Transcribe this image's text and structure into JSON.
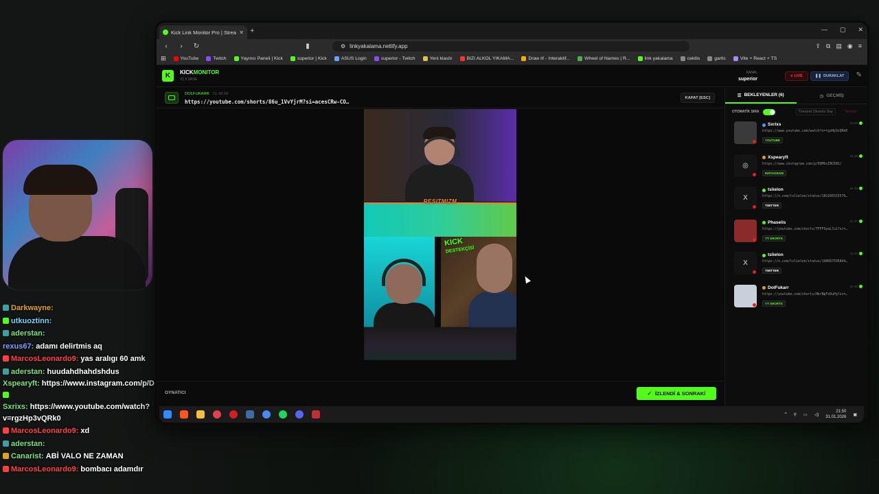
{
  "browser": {
    "tab_title": "Kick Link Monitor Pro | Stream",
    "address": "linkyakalama.netlify.app",
    "bookmarks": [
      {
        "label": "YouTube",
        "color": "#ff0000"
      },
      {
        "label": "Twitch",
        "color": "#9146ff"
      },
      {
        "label": "Yayıncı Paneli | Kick",
        "color": "#53fc18"
      },
      {
        "label": "superior | Kick",
        "color": "#53fc18"
      },
      {
        "label": "ASUS Login",
        "color": "#6aa0ff"
      },
      {
        "label": "superior - Twitch",
        "color": "#9146ff"
      },
      {
        "label": "Yeni klasör",
        "color": "#e0c050"
      },
      {
        "label": "BIZI ALKOL YIKAMA...",
        "color": "#ff3030"
      },
      {
        "label": "Draw it! - Interaktif...",
        "color": "#ffaa00"
      },
      {
        "label": "Wheel of Names | R...",
        "color": "#4caf50"
      },
      {
        "label": "link yakalama",
        "color": "#53fc18"
      },
      {
        "label": "cekilis",
        "color": "#888888"
      },
      {
        "label": "gartic",
        "color": "#888888"
      },
      {
        "label": "Vite + React + TS",
        "color": "#a78bfa"
      }
    ]
  },
  "app": {
    "logo_letter": "K",
    "brand_kick": "KICK",
    "brand_monitor": "MONITOR",
    "version": "V1.5 SRSE",
    "channel_label": "KANAL",
    "channel_name": "superior",
    "live_label": "LIVE",
    "pause_label": "DURAKLAT",
    "now_playing": {
      "user": "DOLFUKARR",
      "time": "21:49:58",
      "url": "https://youtube.com/shorts/86u_1VvYjrM?si=acesCRw-CO…"
    },
    "close_label": "KAPAT [ESC]",
    "video_overlay_text": "RESITMIZM",
    "video_kick_text": "KICK",
    "video_kick_sub": "DESTEKÇİSİ",
    "footer_label": "OYNATICI",
    "next_label": "İZLENDİ & SONRAKİ"
  },
  "side": {
    "tab_waiting": "BEKLEYENLER (6)",
    "tab_history": "GEÇMİŞ",
    "auto_label": "OTOMATİK SIRA",
    "read_all": "Tümünü Okundu Say",
    "clear": "Temizle",
    "queue": [
      {
        "user": "Sxrixs",
        "url": "https://www.youtube.com/watch?v=rgzHp3vQRk0",
        "tag": "YOUTUBE",
        "time": "21:50",
        "dot": "#3aa0ff",
        "thumb": "",
        "tag_color": "#53fc18"
      },
      {
        "user": "Xspearyft",
        "url": "https://www.instagram.com/p/DQMUsIBCEN1/",
        "tag": "INSTAGRAM",
        "time": "21:49",
        "dot": "#e0a020",
        "thumb": "◎",
        "tag_color": "#53fc18"
      },
      {
        "user": "tslielon",
        "url": "https://x.com/tslielon/status/182160315576…",
        "tag": "TWITTER",
        "time": "21:48",
        "dot": "#53fc18",
        "thumb": "X",
        "tag_color": "#ffffff"
      },
      {
        "user": "Phaselis",
        "url": "https://youtube.com/shorts/TFFF9yaL7u1?si=…",
        "tag": "YT SHORTS",
        "time": "21:47",
        "dot": "#53fc18",
        "thumb": "",
        "tag_color": "#53fc18"
      },
      {
        "user": "tslielon",
        "url": "https://x.com/tslielon/status/198067595844…",
        "tag": "TWITTER",
        "time": "21:47",
        "dot": "#53fc18",
        "thumb": "X",
        "tag_color": "#ffffff"
      },
      {
        "user": "DolFukarr",
        "url": "https://youtube.com/shorts/HbrNpFxDuPg?si=…",
        "tag": "YT SHORTS",
        "time": "21:46",
        "dot": "#e0a020",
        "thumb": "",
        "tag_color": "#53fc18"
      }
    ]
  },
  "chat": [
    {
      "user": "Darkwayne:",
      "color": "#e0a020",
      "msg": "",
      "badge": "#3aa0a0"
    },
    {
      "user": "utkuoztinn:",
      "color": "#7fd0ff",
      "msg": "",
      "badge": "#53fc18"
    },
    {
      "user": "aderstan:",
      "color": "#7fe07f",
      "msg": "",
      "badge": "#3aa0a0"
    },
    {
      "user": "rexus67:",
      "color": "#7f9fff",
      "msg": "adamı delirtmis aq",
      "badge": ""
    },
    {
      "user": "MarcosLeonardo9:",
      "color": "#ff4040",
      "msg": "yas aralıgı 60 amk",
      "badge": "#ff4040"
    },
    {
      "user": "aderstan:",
      "color": "#7fe07f",
      "msg": "huudahdhahdshdus",
      "badge": "#3aa0a0"
    },
    {
      "user": "Xspearyft:",
      "color": "#7fe07f",
      "msg": "https://www.instagram.com/p/DQMUsIBC",
      "badge": "",
      "wrap": true
    },
    {
      "user": "Sxrixs:",
      "color": "#7fe07f",
      "msg": "https://www.youtube.com/watch?v=rgzHp3vQRk0",
      "badge": "#53fc18",
      "wrap": true
    },
    {
      "user": "MarcosLeonardo9:",
      "color": "#ff4040",
      "msg": "xd",
      "badge": "#ff4040"
    },
    {
      "user": "aderstan:",
      "color": "#7fe07f",
      "msg": "",
      "badge": "#3aa0a0"
    },
    {
      "user": "Canarist:",
      "color": "#7fe07f",
      "msg": "ABİ VALO NE ZAMAN",
      "badge": "#e0a020"
    },
    {
      "user": "MarcosLeonardo9:",
      "color": "#ff4040",
      "msg": "bombacı adamdır",
      "badge": "#ff4040"
    }
  ],
  "taskbar": {
    "time": "21:50",
    "date": "31.01.2026"
  }
}
